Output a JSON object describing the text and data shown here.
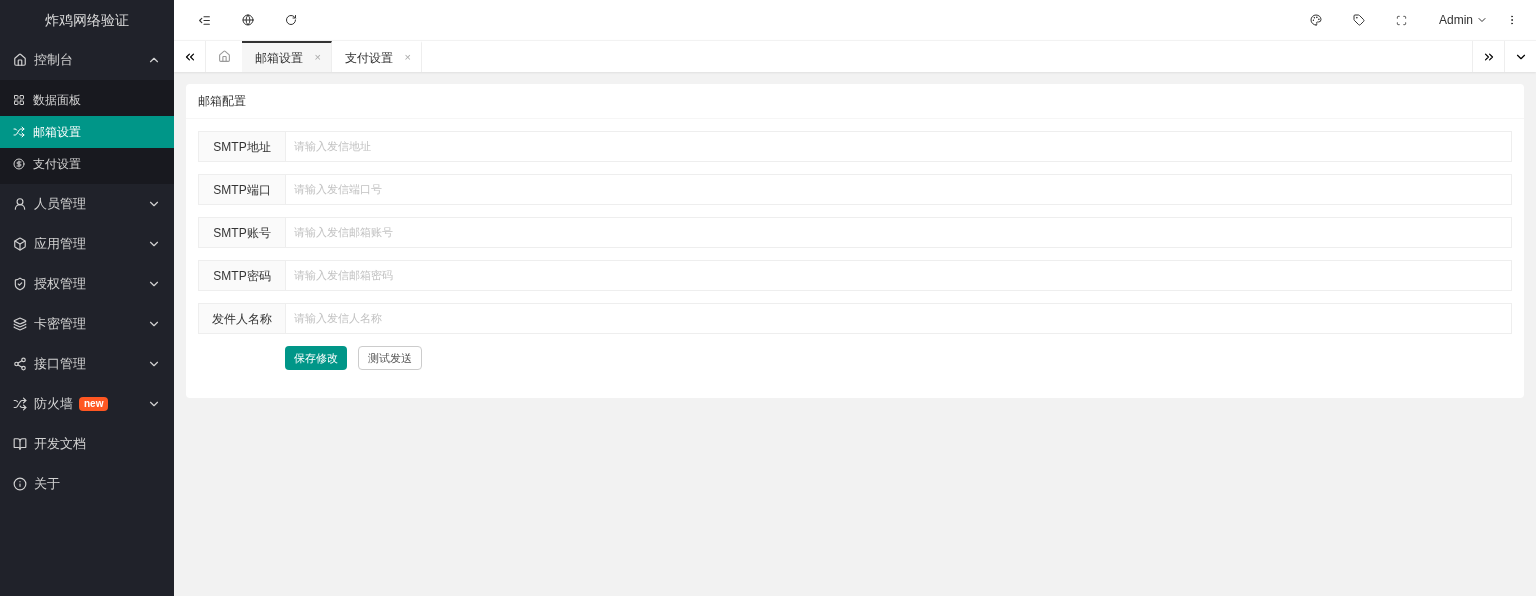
{
  "app": {
    "title": "炸鸡网络验证"
  },
  "sidebar": {
    "items": [
      {
        "label": "控制台",
        "expanded": true,
        "children": [
          {
            "label": "数据面板",
            "selected": false
          },
          {
            "label": "邮箱设置",
            "selected": true
          },
          {
            "label": "支付设置",
            "selected": false
          }
        ]
      },
      {
        "label": "人员管理",
        "expanded": false
      },
      {
        "label": "应用管理",
        "expanded": false
      },
      {
        "label": "授权管理",
        "expanded": false
      },
      {
        "label": "卡密管理",
        "expanded": false
      },
      {
        "label": "接口管理",
        "expanded": false
      },
      {
        "label": "防火墙",
        "expanded": false,
        "badge": "new"
      },
      {
        "label": "开发文档"
      },
      {
        "label": "关于"
      }
    ]
  },
  "header": {
    "user": "Admin"
  },
  "tabs": [
    {
      "label": "邮箱设置",
      "selected": true,
      "close": "×"
    },
    {
      "label": "支付设置",
      "selected": false,
      "close": "×"
    }
  ],
  "card": {
    "title": "邮箱配置",
    "fields": [
      {
        "label": "SMTP地址",
        "placeholder": "请输入发信地址"
      },
      {
        "label": "SMTP端口",
        "placeholder": "请输入发信端口号"
      },
      {
        "label": "SMTP账号",
        "placeholder": "请输入发信邮箱账号"
      },
      {
        "label": "SMTP密码",
        "placeholder": "请输入发信邮箱密码"
      },
      {
        "label": "发件人名称",
        "placeholder": "请输入发信人名称"
      }
    ],
    "buttons": [
      {
        "label": "保存修改",
        "kind": "primary"
      },
      {
        "label": "测试发送",
        "kind": "default"
      }
    ]
  }
}
